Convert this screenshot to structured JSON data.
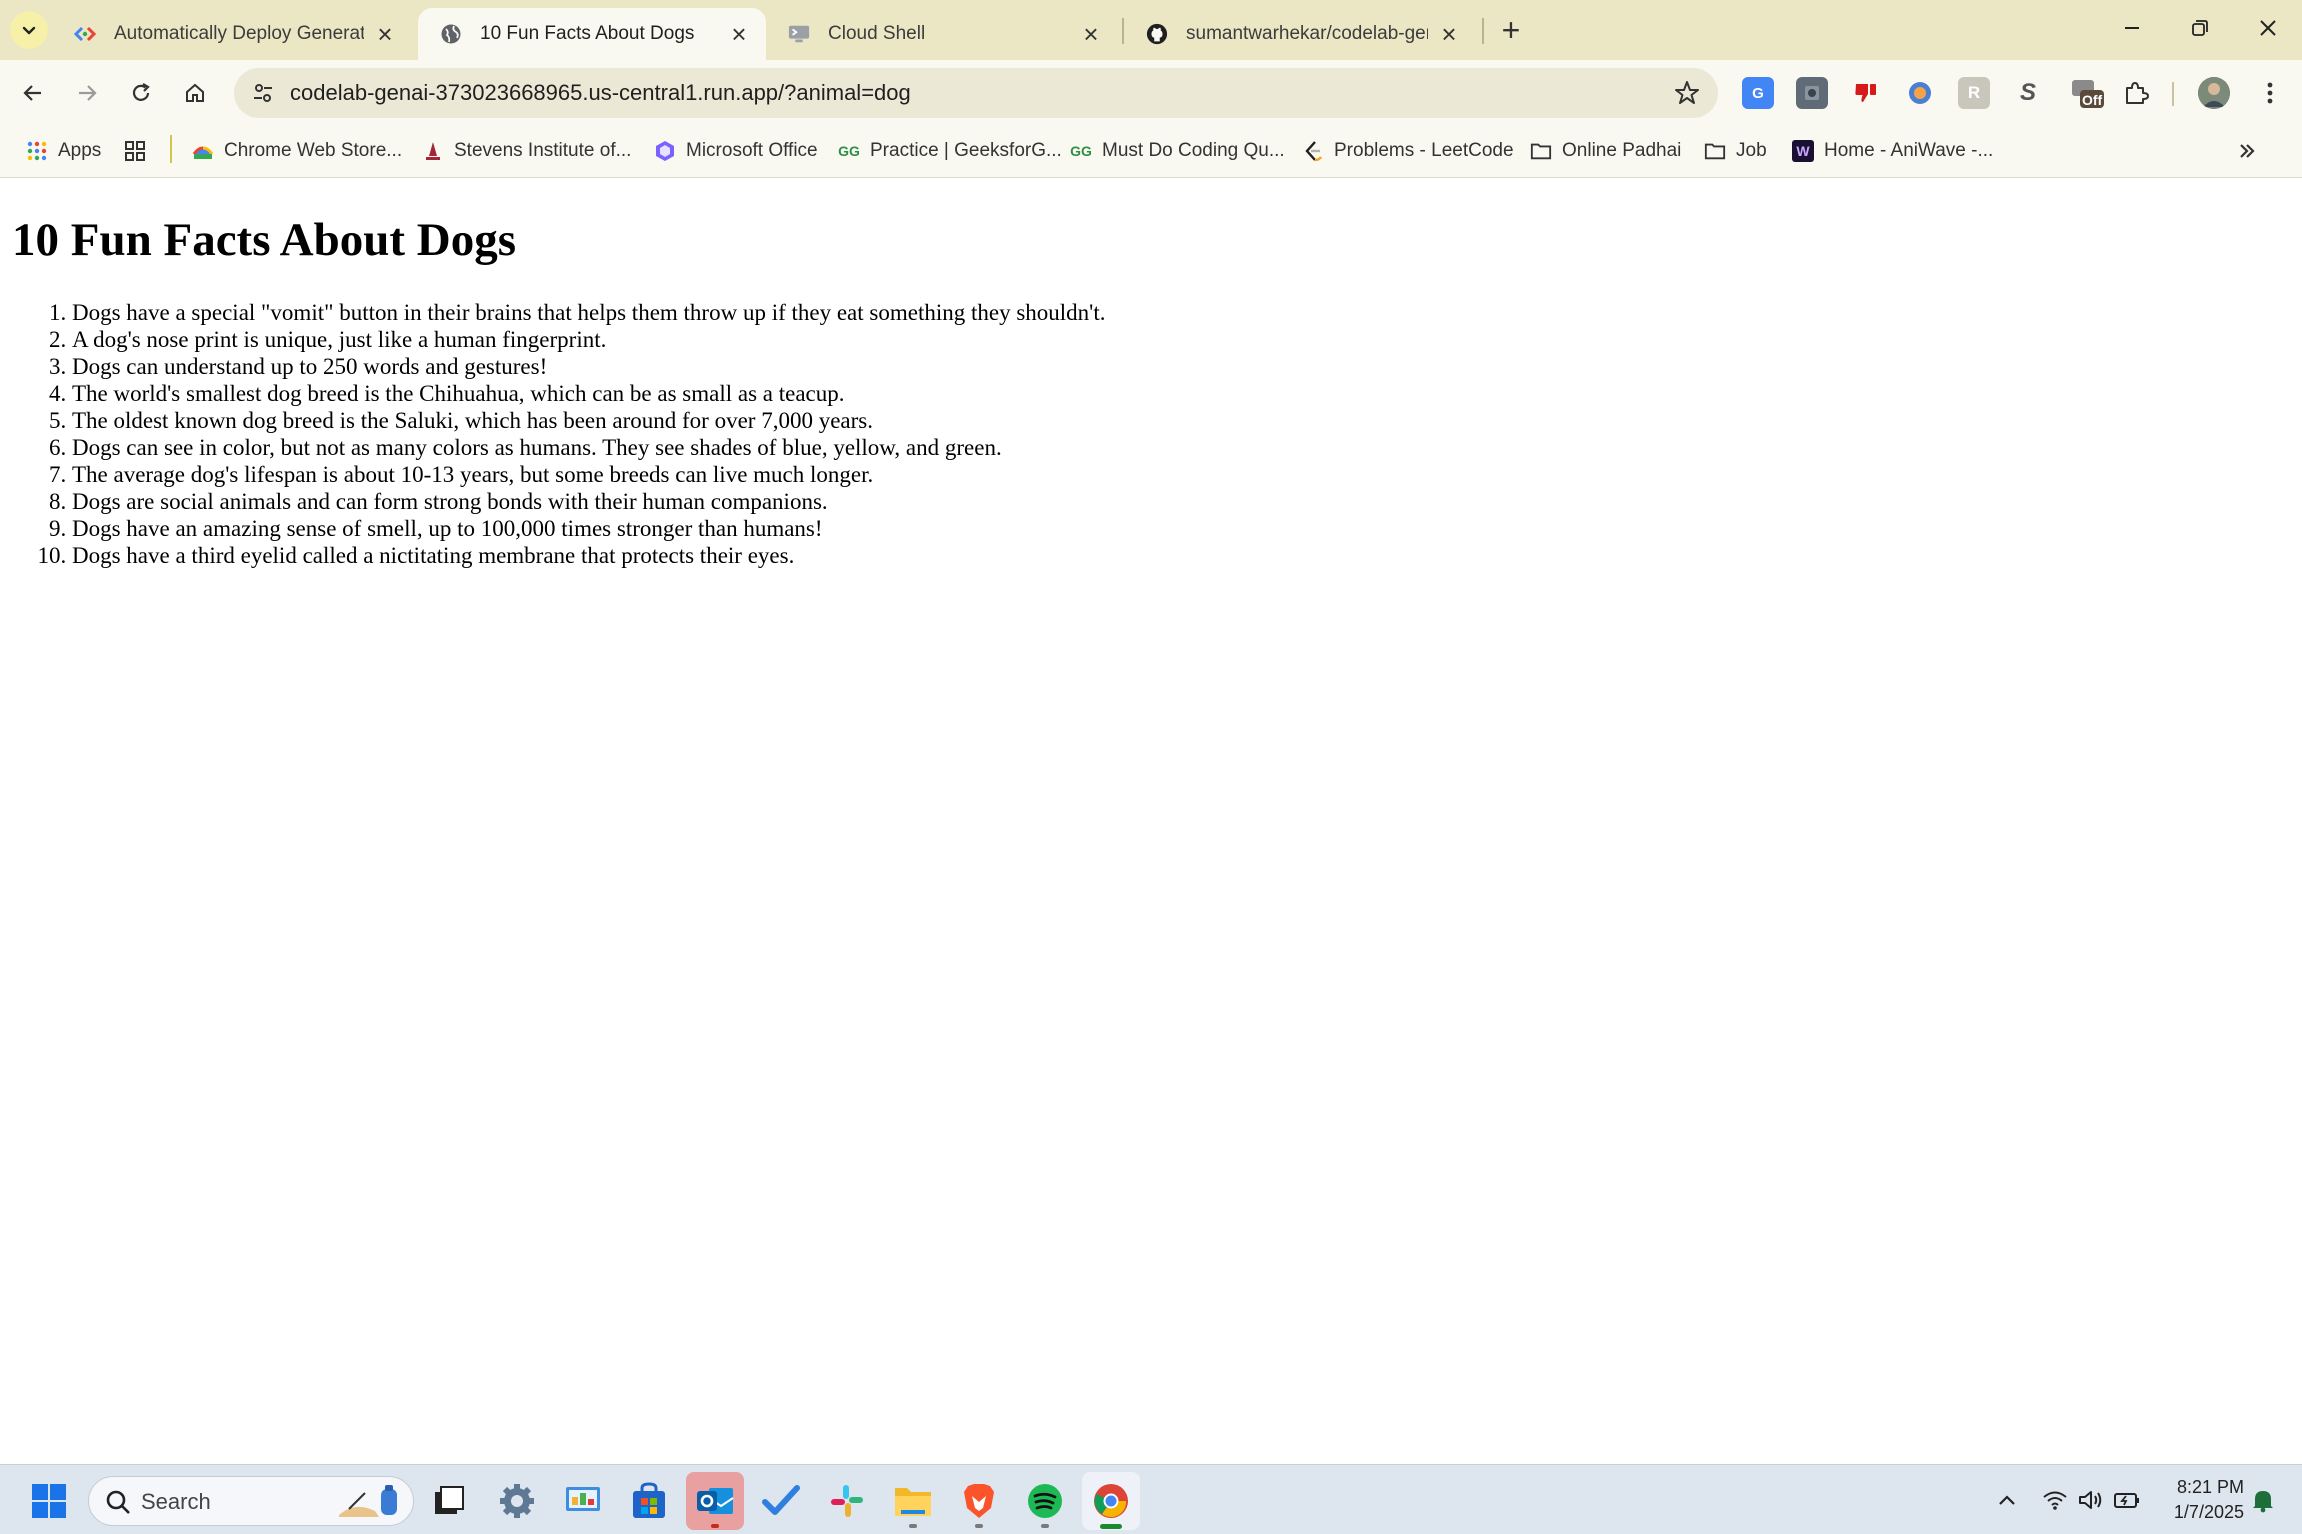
{
  "browser": {
    "tabs": [
      {
        "title": "Automatically Deploy Generativ",
        "favicon": "codelabs-icon",
        "active": false
      },
      {
        "title": "10 Fun Facts About Dogs",
        "favicon": "globe-icon",
        "active": true
      },
      {
        "title": "Cloud Shell",
        "favicon": "cloud-shell-icon",
        "active": false
      },
      {
        "title": "sumantwarhekar/codelab-gena",
        "favicon": "github-icon",
        "active": false
      }
    ],
    "address_bar": {
      "url": "codelab-genai-373023668965.us-central1.run.app/?animal=dog"
    },
    "extensions": {
      "off_badge": "Off"
    },
    "bookmarks": [
      {
        "label": "Apps",
        "icon": "apps-grid-icon"
      },
      {
        "label": "",
        "icon": "tab-groups-icon"
      },
      {
        "label": "Chrome Web Store...",
        "icon": "chrome-web-store-icon"
      },
      {
        "label": "Stevens Institute of...",
        "icon": "stevens-icon"
      },
      {
        "label": "Microsoft Office",
        "icon": "office-icon"
      },
      {
        "label": "Practice | GeeksforG...",
        "icon": "geeksforgeeks-icon"
      },
      {
        "label": "Must Do Coding Qu...",
        "icon": "geeksforgeeks-icon"
      },
      {
        "label": "Problems - LeetCode",
        "icon": "leetcode-icon"
      },
      {
        "label": "Online Padhai",
        "icon": "folder-icon"
      },
      {
        "label": "Job",
        "icon": "folder-icon"
      },
      {
        "label": "Home - AniWave -...",
        "icon": "aniwave-icon"
      }
    ]
  },
  "page": {
    "title": "10 Fun Facts About Dogs",
    "facts": [
      "Dogs have a special \"vomit\" button in their brains that helps them throw up if they eat something they shouldn't.",
      "A dog's nose print is unique, just like a human fingerprint.",
      "Dogs can understand up to 250 words and gestures!",
      "The world's smallest dog breed is the Chihuahua, which can be as small as a teacup.",
      "The oldest known dog breed is the Saluki, which has been around for over 7,000 years.",
      "Dogs can see in color, but not as many colors as humans. They see shades of blue, yellow, and green.",
      "The average dog's lifespan is about 10-13 years, but some breeds can live much longer.",
      "Dogs are social animals and can form strong bonds with their human companions.",
      "Dogs have an amazing sense of smell, up to 100,000 times stronger than humans!",
      "Dogs have a third eyelid called a nictitating membrane that protects their eyes."
    ]
  },
  "taskbar": {
    "search_label": "Search",
    "clock_time": "8:21 PM",
    "clock_date": "1/7/2025"
  },
  "colors": {
    "tabstrip_bg": "#ebe6c4",
    "toolbar_bg": "#f9f9f1",
    "omnibox_bg": "#ece8d6",
    "taskbar_bg": "#dde5ef"
  }
}
